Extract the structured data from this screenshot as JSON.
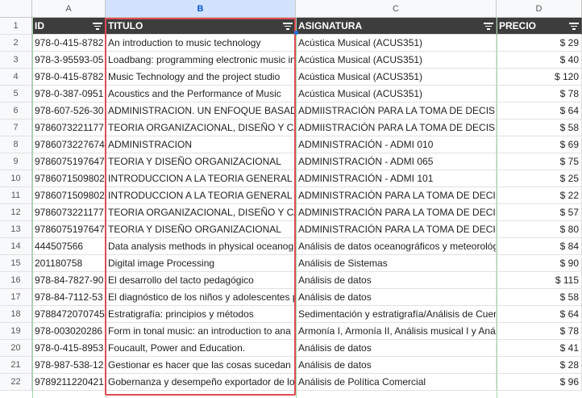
{
  "columns": [
    "A",
    "B",
    "C",
    "D"
  ],
  "headers": [
    "ID",
    "TITULO",
    "ASIGNATURA",
    "PRECIO"
  ],
  "rows": [
    {
      "n": "2",
      "id": "978-0-415-8782",
      "titulo": "An introduction to music technology",
      "asig": "Acústica Musical (ACUS351)",
      "precio": "$ 29"
    },
    {
      "n": "3",
      "id": "978-3-95593-05",
      "titulo": "Loadbang: programming electronic music in",
      "asig": "Acústica Musical (ACUS351)",
      "precio": "$ 40"
    },
    {
      "n": "4",
      "id": "978-0-415-8782",
      "titulo": "Music Technology and the project studio",
      "asig": "Acústica Musical (ACUS351)",
      "precio": "$ 120"
    },
    {
      "n": "5",
      "id": "978-0-387-0951",
      "titulo": "Acoustics and the Performance of Music",
      "asig": "Acústica Musical (ACUS351)",
      "precio": "$ 78"
    },
    {
      "n": "6",
      "id": "978-607-526-30",
      "titulo": "ADMINISTRACION. UN ENFOQUE BASADO E",
      "asig": "ADMIISTRACIÓN PARA LA TOMA DE DECISION",
      "precio": "$ 64"
    },
    {
      "n": "7",
      "id": "9786073221177",
      "titulo": "TEORIA ORGANIZACIONAL, DISEÑO Y CAMB",
      "asig": "ADMIISTRACIÓN PARA LA TOMA DE DECISION",
      "precio": "$ 58"
    },
    {
      "n": "8",
      "id": "9786073227674",
      "titulo": "ADMINISTRACION",
      "asig": "ADMINISTRACIÓN - ADMI 010",
      "precio": "$ 69"
    },
    {
      "n": "9",
      "id": "9786075197647",
      "titulo": "TEORIA Y DISEÑO ORGANIZACIONAL",
      "asig": "ADMINISTRACIÓN - ADMI 065",
      "precio": "$ 75"
    },
    {
      "n": "10",
      "id": "9786071509802",
      "titulo": "INTRODUCCION A LA TEORIA GENERAL DE L",
      "asig": "ADMINISTRACIÓN - ADMI 101",
      "precio": "$ 25"
    },
    {
      "n": "11",
      "id": "9786071509802",
      "titulo": "INTRODUCCION A LA TEORIA GENERAL DE L",
      "asig": "ADMINISTRACIÓN PARA LA TOMA DE DECISIO",
      "precio": "$ 22"
    },
    {
      "n": "12",
      "id": "9786073221177",
      "titulo": "TEORIA ORGANIZACIONAL, DISEÑO Y CAMB",
      "asig": "ADMINISTRACIÓN PARA LA TOMA DE DECISIO",
      "precio": "$ 57"
    },
    {
      "n": "13",
      "id": "9786075197647",
      "titulo": "TEORIA Y DISEÑO ORGANIZACIONAL",
      "asig": "ADMINISTRACIÓN PARA LA TOMA DE DECISIO",
      "precio": "$ 80"
    },
    {
      "n": "14",
      "id": "444507566",
      "titulo": "Data analysis methods in physical oceanogr",
      "asig": "Análisis de datos oceanográficos y meteorológ",
      "precio": "$ 84"
    },
    {
      "n": "15",
      "id": "201180758",
      "titulo": "Digital image Processing",
      "asig": "Análisis de Sistemas",
      "precio": "$ 90"
    },
    {
      "n": "16",
      "id": "978-84-7827-90",
      "titulo": "El desarrollo del tacto pedagógico",
      "asig": "Análisis de datos",
      "precio": "$ 115"
    },
    {
      "n": "17",
      "id": "978-84-7112-53",
      "titulo": "El diagnóstico de los niños y adolescentes p",
      "asig": "Análisis de datos",
      "precio": "$ 58"
    },
    {
      "n": "18",
      "id": "9788472070745",
      "titulo": "Estratigrafía: principios y métodos",
      "asig": "Sedimentación y estratigrafía/Análisis de Cuen",
      "precio": "$ 64"
    },
    {
      "n": "19",
      "id": "978-003020286",
      "titulo": "Form in tonal music: an introduction to ana",
      "asig": "Armonía I, Armonía II, Análisis musical I y Anál",
      "precio": "$ 78"
    },
    {
      "n": "20",
      "id": "978-0-415-8953",
      "titulo": "Foucault, Power and Education.",
      "asig": "Análisis de datos",
      "precio": "$ 41"
    },
    {
      "n": "21",
      "id": "978-987-538-12",
      "titulo": "Gestionar es hacer que las cosas sucedan",
      "asig": "Análisis de datos",
      "precio": "$ 28"
    },
    {
      "n": "22",
      "id": "9789211220421",
      "titulo": "Gobernanza y desempeño exportador de lo",
      "asig": "Análisis de Política Comercial",
      "precio": "$ 96"
    }
  ]
}
